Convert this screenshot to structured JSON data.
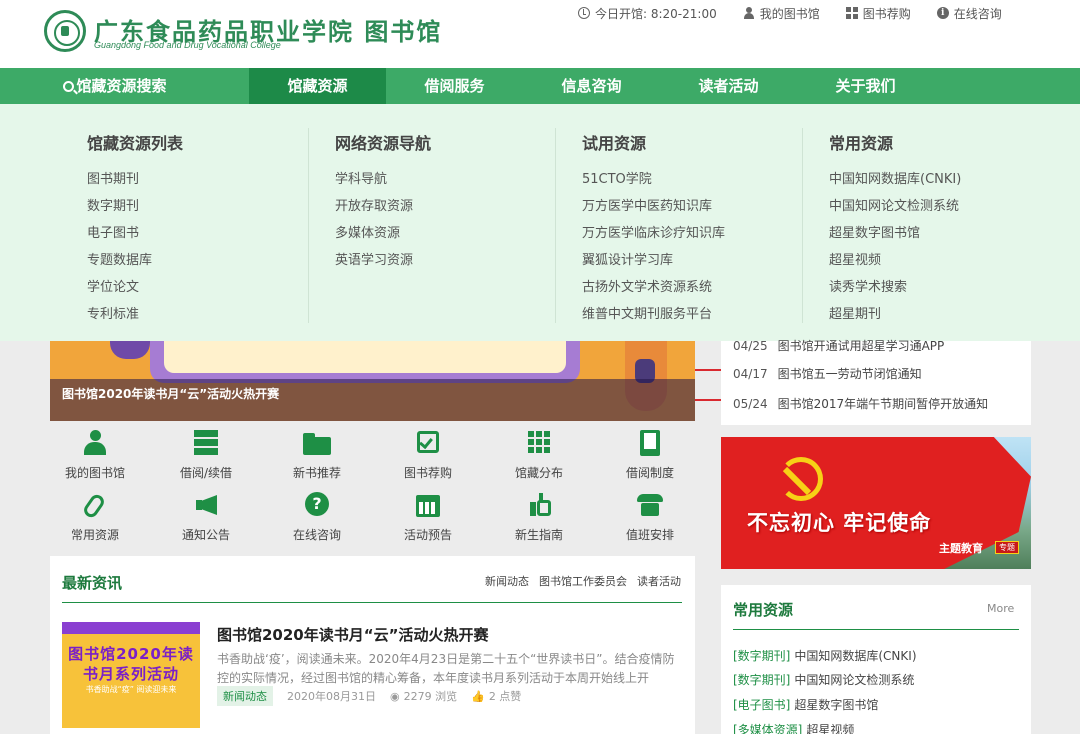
{
  "header": {
    "logo_cn": "广东食品药品职业学院 图书馆",
    "logo_en": "Guangdong Food and Drug Vocational College",
    "links": [
      {
        "icon": "clock-icon",
        "label": "今日开馆: 8:20-21:00"
      },
      {
        "icon": "user-icon",
        "label": "我的图书馆"
      },
      {
        "icon": "grid-icon",
        "label": "图书荐购"
      },
      {
        "icon": "info-icon",
        "label": "在线咨询"
      }
    ]
  },
  "nav": {
    "items": [
      "馆藏资源搜索",
      "馆藏资源",
      "借阅服务",
      "信息咨询",
      "读者活动",
      "关于我们"
    ]
  },
  "dropdown": {
    "columns": [
      {
        "title": "馆藏资源列表",
        "items": [
          "图书期刊",
          "数字期刊",
          "电子图书",
          "专题数据库",
          "学位论文",
          "专利标准"
        ]
      },
      {
        "title": "网络资源导航",
        "items": [
          "学科导航",
          "开放存取资源",
          "多媒体资源",
          "英语学习资源"
        ]
      },
      {
        "title": "试用资源",
        "items": [
          "51CTO学院",
          "万方医学中医药知识库",
          "万方医学临床诊疗知识库",
          "翼狐设计学习库",
          "古扬外文学术资源系统",
          "维普中文期刊服务平台"
        ]
      },
      {
        "title": "常用资源",
        "items": [
          "中国知网数据库(CNKI)",
          "中国知网论文检测系统",
          "超星数字图书馆",
          "超星视频",
          "读秀学术搜索",
          "超星期刊"
        ]
      }
    ]
  },
  "banner": {
    "title": "图书馆2020年读书月“云”活动火热开赛"
  },
  "news_list": [
    {
      "date": "04/25",
      "title": "图书馆开通试用超星学习通APP"
    },
    {
      "date": "04/17",
      "title": "图书馆五一劳动节闭馆通知"
    },
    {
      "date": "05/24",
      "title": "图书馆2017年端午节期间暂停开放通知"
    }
  ],
  "quick_links": [
    {
      "label": "我的图书馆",
      "icon": "user-icon"
    },
    {
      "label": "借阅/续借",
      "icon": "server-icon"
    },
    {
      "label": "新书推荐",
      "icon": "folder-icon"
    },
    {
      "label": "图书荐购",
      "icon": "check-square-icon"
    },
    {
      "label": "馆藏分布",
      "icon": "grid-icon"
    },
    {
      "label": "借阅制度",
      "icon": "book-icon"
    },
    {
      "label": "常用资源",
      "icon": "paperclip-icon"
    },
    {
      "label": "通知公告",
      "icon": "megaphone-icon"
    },
    {
      "label": "在线咨询",
      "icon": "question-icon"
    },
    {
      "label": "活动预告",
      "icon": "calendar-icon"
    },
    {
      "label": "新生指南",
      "icon": "hand-pointer-icon"
    },
    {
      "label": "值班安排",
      "icon": "phone-icon"
    }
  ],
  "party_banner": {
    "slogan": "不忘初心 牢记使命",
    "sub": "主题教育",
    "tag": "专题"
  },
  "latest": {
    "heading": "最新资讯",
    "tabs": [
      "新闻动态",
      "图书馆工作委员会",
      "读者活动"
    ],
    "thumb_text": "图书馆2020年读书月系列活动",
    "thumb_sub": "书香助战“疫” 阅读迎未来",
    "article": {
      "title": "图书馆2020年读书月“云”活动火热开赛",
      "desc": "书香助战‘疫’，阅读通未来。2020年4月23日是第二十五个“世界读书日”。结合疫情防控的实际情况，经过图书馆的精心筹备，本年度读书月系列活动于本周开始线上开赛。...",
      "category": "新闻动态",
      "date": "2020年08月31日",
      "views": "2279 浏览",
      "likes": "2 点赞"
    }
  },
  "common_resources": {
    "heading": "常用资源",
    "more": "More",
    "items": [
      {
        "type": "[数字期刊]",
        "name": "中国知网数据库(CNKI)"
      },
      {
        "type": "[数字期刊]",
        "name": "中国知网论文检测系统"
      },
      {
        "type": "[电子图书]",
        "name": "超星数字图书馆"
      },
      {
        "type": "[多媒体资源]",
        "name": "超星视频"
      }
    ]
  },
  "colors": {
    "brand_green": "#3daa67",
    "nav_active": "#1d8a48",
    "highlight_box": "#d9292f"
  }
}
